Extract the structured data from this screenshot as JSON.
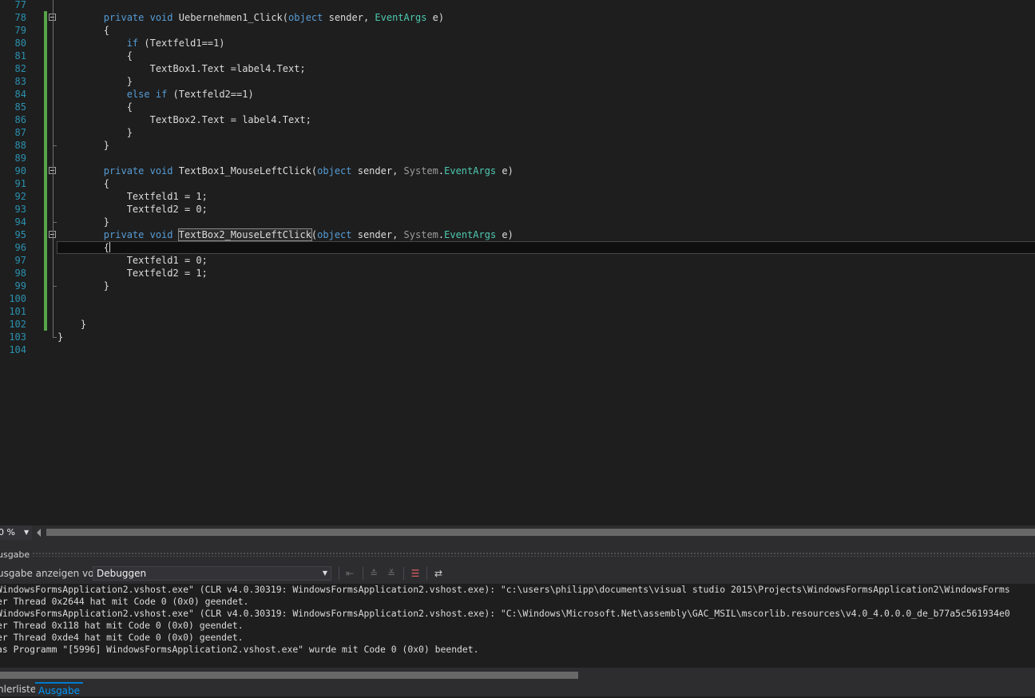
{
  "editor": {
    "lines": [
      {
        "n": "77",
        "html": ""
      },
      {
        "n": "78",
        "html": "        <span class=\"kw\">private</span> <span class=\"kw\">void</span> Uebernehmen1_Click(<span class=\"kw\">object</span> sender, <span class=\"ty\">EventArgs</span> e)"
      },
      {
        "n": "79",
        "html": "        {"
      },
      {
        "n": "80",
        "html": "            <span class=\"kw\">if</span> (Textfeld1==1)"
      },
      {
        "n": "81",
        "html": "            {"
      },
      {
        "n": "82",
        "html": "                TextBox1.Text =label4.Text;"
      },
      {
        "n": "83",
        "html": "            }"
      },
      {
        "n": "84",
        "html": "            <span class=\"kw\">else</span> <span class=\"kw\">if</span> (Textfeld2==1)"
      },
      {
        "n": "85",
        "html": "            {"
      },
      {
        "n": "86",
        "html": "                TextBox2.Text = label4.Text;"
      },
      {
        "n": "87",
        "html": "            }"
      },
      {
        "n": "88",
        "html": "        }"
      },
      {
        "n": "89",
        "html": ""
      },
      {
        "n": "90",
        "html": "        <span class=\"kw\">private</span> <span class=\"kw\">void</span> TextBox1_MouseLeftClick(<span class=\"kw\">object</span> sender, <span class=\"ns\">System</span>.<span class=\"ty\">EventArgs</span> e)"
      },
      {
        "n": "91",
        "html": "        {"
      },
      {
        "n": "92",
        "html": "            Textfeld1 = 1;"
      },
      {
        "n": "93",
        "html": "            Textfeld2 = 0;"
      },
      {
        "n": "94",
        "html": "        }"
      },
      {
        "n": "95",
        "html": "        <span class=\"kw\">private</span> <span class=\"kw\">void</span> <span class=\"hl\">TextBox2_MouseLeftClick</span>(<span class=\"kw\">object</span> sender, <span class=\"ns\">System</span>.<span class=\"ty\">EventArgs</span> e)"
      },
      {
        "n": "96",
        "html": "        {<span class=\"caret\"></span>"
      },
      {
        "n": "97",
        "html": "            Textfeld1 = 0;"
      },
      {
        "n": "98",
        "html": "            Textfeld2 = 1;"
      },
      {
        "n": "99",
        "html": "        }"
      },
      {
        "n": "100",
        "html": ""
      },
      {
        "n": "101",
        "html": ""
      },
      {
        "n": "102",
        "html": "    }"
      },
      {
        "n": "103",
        "html": "}"
      },
      {
        "n": "104",
        "html": ""
      }
    ],
    "current_line": "96",
    "zoom": "0 %"
  },
  "output": {
    "title": "usgabe",
    "show_label": "usgabe anzeigen von:",
    "source_selected": "Debuggen",
    "lines": [
      "WindowsFormsApplication2.vshost.exe\" (CLR v4.0.30319: WindowsFormsApplication2.vshost.exe): \"c:\\users\\philipp\\documents\\visual studio 2015\\Projects\\WindowsFormsApplication2\\WindowsForms",
      "er Thread 0x2644 hat mit Code 0 (0x0) geendet.",
      "WindowsFormsApplication2.vshost.exe\" (CLR v4.0.30319: WindowsFormsApplication2.vshost.exe): \"C:\\Windows\\Microsoft.Net\\assembly\\GAC_MSIL\\mscorlib.resources\\v4.0_4.0.0.0_de_b77a5c561934e0",
      "er Thread 0x118 hat mit Code 0 (0x0) geendet.",
      "er Thread 0xde4 hat mit Code 0 (0x0) geendet.",
      "as Programm \"[5996] WindowsFormsApplication2.vshost.exe\" wurde mit Code 0 (0x0) beendet."
    ]
  },
  "tabs": [
    {
      "label": "hlerliste",
      "active": false
    },
    {
      "label": "Ausgabe",
      "active": true
    }
  ],
  "toolbar_icons": [
    "go-to-previous-message-icon",
    "go-to-previous-icon",
    "go-to-next-icon",
    "clear-all-icon",
    "toggle-word-wrap-icon"
  ]
}
